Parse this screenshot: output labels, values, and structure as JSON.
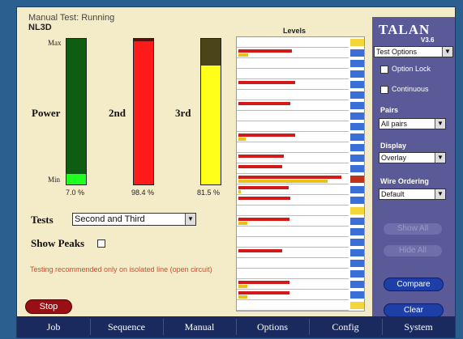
{
  "header": {
    "title": "Manual Test: Running",
    "subtitle": "NL3D"
  },
  "meters": {
    "max_label": "Max",
    "min_label": "Min",
    "power": {
      "label": "Power",
      "percent": "7.0 %",
      "fill_fraction": 0.07,
      "color": "#1fff1f",
      "track_color": "#0e5d13"
    },
    "second": {
      "label": "2nd",
      "percent": "98.4 %",
      "fill_fraction": 0.984,
      "color": "#ff1a1a",
      "track_color": "#5b0f0f"
    },
    "third": {
      "label": "3rd",
      "percent": "81.5 %",
      "fill_fraction": 0.815,
      "color": "#ffff1a",
      "track_color": "#4a4418"
    }
  },
  "levels": {
    "title": "Levels",
    "rows": [
      {
        "yellow": 0,
        "red": 0,
        "chip": "yellow"
      },
      {
        "yellow": 0.09,
        "red": 0.49,
        "chip": "blue"
      },
      {
        "yellow": 0,
        "red": 0,
        "chip": "blue"
      },
      {
        "yellow": 0,
        "red": 0,
        "chip": "blue"
      },
      {
        "yellow": 0,
        "red": 0.52,
        "chip": "blue"
      },
      {
        "yellow": 0,
        "red": 0,
        "chip": "blue"
      },
      {
        "yellow": 0,
        "red": 0.48,
        "chip": "blue"
      },
      {
        "yellow": 0,
        "red": 0,
        "chip": "blue"
      },
      {
        "yellow": 0,
        "red": 0,
        "chip": "blue"
      },
      {
        "yellow": 0.07,
        "red": 0.52,
        "chip": "blue"
      },
      {
        "yellow": 0,
        "red": 0,
        "chip": "blue"
      },
      {
        "yellow": 0,
        "red": 0.42,
        "chip": "blue"
      },
      {
        "yellow": 0,
        "red": 0.4,
        "chip": "blue"
      },
      {
        "yellow": 0.82,
        "red": 0.95,
        "chip": "red"
      },
      {
        "yellow": 0.02,
        "red": 0.46,
        "chip": "blue"
      },
      {
        "yellow": 0,
        "red": 0.48,
        "chip": "blue"
      },
      {
        "yellow": 0,
        "red": 0,
        "chip": "yellow"
      },
      {
        "yellow": 0.08,
        "red": 0.47,
        "chip": "blue"
      },
      {
        "yellow": 0,
        "red": 0,
        "chip": "blue"
      },
      {
        "yellow": 0,
        "red": 0,
        "chip": "blue"
      },
      {
        "yellow": 0,
        "red": 0.4,
        "chip": "blue"
      },
      {
        "yellow": 0,
        "red": 0,
        "chip": "blue"
      },
      {
        "yellow": 0,
        "red": 0,
        "chip": "blue"
      },
      {
        "yellow": 0.08,
        "red": 0.47,
        "chip": "blue"
      },
      {
        "yellow": 0.08,
        "red": 0.47,
        "chip": "blue"
      },
      {
        "yellow": 0,
        "red": 0,
        "chip": "yellow"
      }
    ]
  },
  "tests": {
    "label": "Tests",
    "selected": "Second and Third"
  },
  "show_peaks": {
    "label": "Show Peaks",
    "checked": false
  },
  "warning": "Testing recommended only on isolated line (open circuit)",
  "stop_button": "Stop",
  "sidebar": {
    "logo": "TALAN",
    "version": "V3.6",
    "test_options": "Test Options",
    "option_lock": "Option Lock",
    "continuous": "Continuous",
    "pairs_label": "Pairs",
    "pairs_value": "All pairs",
    "display_label": "Display",
    "display_value": "Overlay",
    "wire_label": "Wire Ordering",
    "wire_value": "Default",
    "show_all": "Show All",
    "hide_all": "Hide All",
    "compare": "Compare",
    "clear": "Clear"
  },
  "tabs": [
    "Job",
    "Sequence",
    "Manual",
    "Options",
    "Config",
    "System"
  ],
  "colors": {
    "chip_blue": "#3a6fd8",
    "chip_yellow": "#f2d63c",
    "chip_red": "#c0331a"
  }
}
